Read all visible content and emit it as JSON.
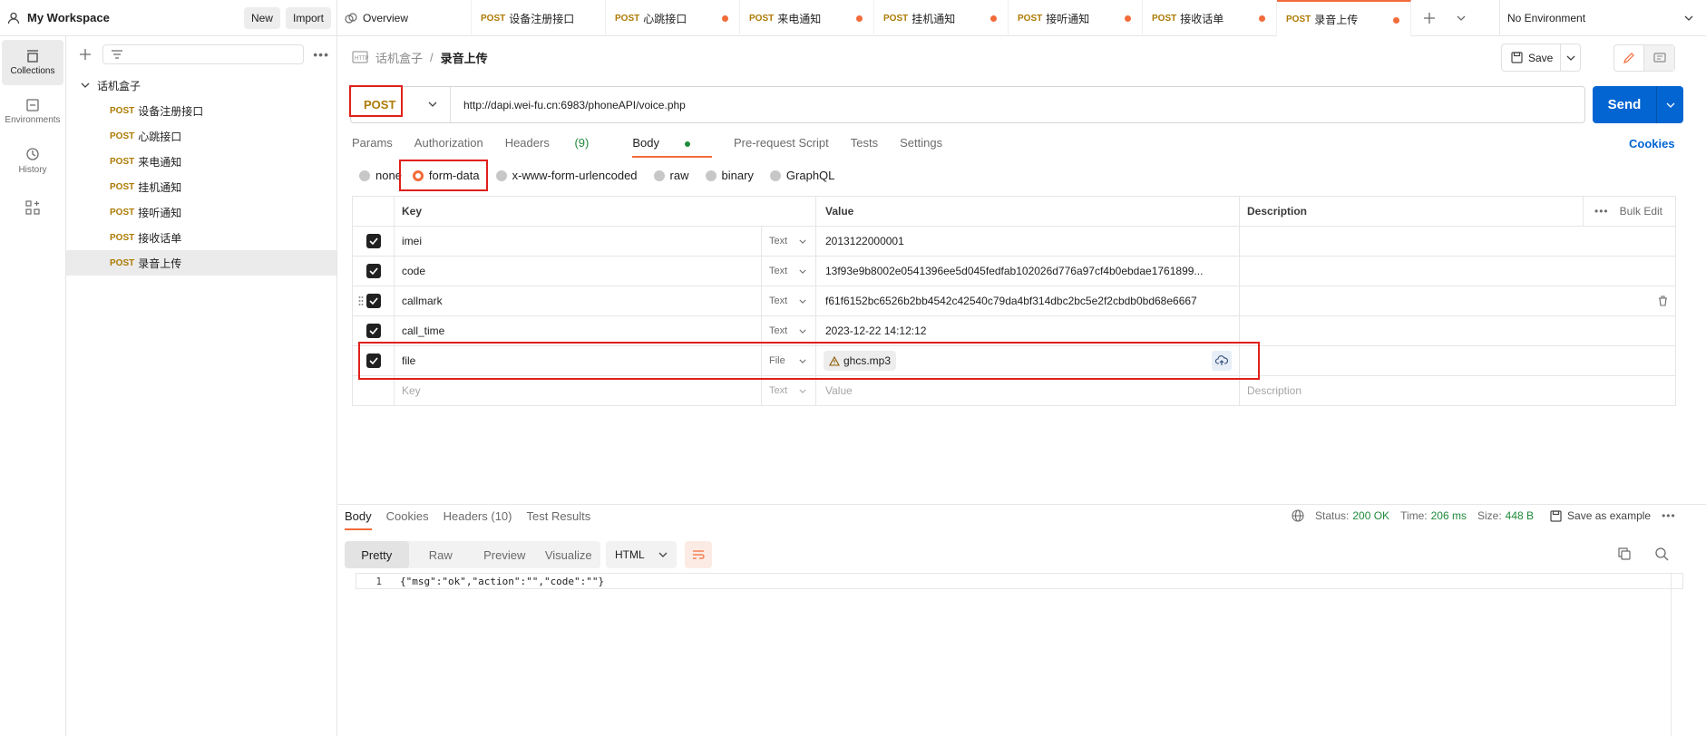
{
  "workspace": {
    "name": "My Workspace",
    "new_label": "New",
    "import_label": "Import"
  },
  "tabs": [
    {
      "label": "Overview"
    },
    {
      "method": "POST",
      "label": "设备注册接口"
    },
    {
      "method": "POST",
      "label": "心跳接口"
    },
    {
      "method": "POST",
      "label": "来电通知"
    },
    {
      "method": "POST",
      "label": "挂机通知"
    },
    {
      "method": "POST",
      "label": "接听通知"
    },
    {
      "method": "POST",
      "label": "接收话单"
    },
    {
      "method": "POST",
      "label": "录音上传"
    }
  ],
  "environment": "No Environment",
  "rail": [
    {
      "label": "Collections"
    },
    {
      "label": "Environments"
    },
    {
      "label": "History"
    }
  ],
  "collection": {
    "name": "话机盒子",
    "items": [
      {
        "method": "POST",
        "label": "设备注册接口"
      },
      {
        "method": "POST",
        "label": "心跳接口"
      },
      {
        "method": "POST",
        "label": "来电通知"
      },
      {
        "method": "POST",
        "label": "挂机通知"
      },
      {
        "method": "POST",
        "label": "接听通知"
      },
      {
        "method": "POST",
        "label": "接收话单"
      },
      {
        "method": "POST",
        "label": "录音上传"
      }
    ]
  },
  "breadcrumb": {
    "parent": "话机盒子",
    "sep": "/",
    "current": "录音上传"
  },
  "save_label": "Save",
  "request": {
    "method": "POST",
    "url": "http://dapi.wei-fu.cn:6983/phoneAPI/voice.php",
    "send_label": "Send"
  },
  "req_tabs": [
    "Params",
    "Authorization",
    "Headers",
    "(9)",
    "Body",
    "Pre-request Script",
    "Tests",
    "Settings"
  ],
  "cookies_label": "Cookies",
  "body_types": [
    "none",
    "form-data",
    "x-www-form-urlencoded",
    "raw",
    "binary",
    "GraphQL"
  ],
  "table": {
    "headers": {
      "key": "Key",
      "value": "Value",
      "description": "Description",
      "bulk": "Bulk Edit"
    },
    "rows": [
      {
        "key": "imei",
        "type": "Text",
        "value": "2013122000001"
      },
      {
        "key": "code",
        "type": "Text",
        "value": "13f93e9b8002e0541396ee5d045fedfab102026d776a97cf4b0ebdae1761899..."
      },
      {
        "key": "callmark",
        "type": "Text",
        "value": "f61f6152bc6526b2bb4542c42540c79da4bf314dbc2bc5e2f2cbdb0bd68e6667"
      },
      {
        "key": "call_time",
        "type": "Text",
        "value": "2023-12-22 14:12:12"
      },
      {
        "key": "file",
        "type": "File",
        "value": "ghcs.mp3"
      }
    ],
    "placeholder": {
      "key": "Key",
      "type": "Text",
      "value": "Value",
      "description": "Description"
    }
  },
  "response": {
    "tabs": [
      "Body",
      "Cookies",
      "Headers (10)",
      "Test Results"
    ],
    "status_label": "Status:",
    "status": "200 OK",
    "time_label": "Time:",
    "time": "206 ms",
    "size_label": "Size:",
    "size": "448 B",
    "save_example": "Save as example",
    "views": [
      "Pretty",
      "Raw",
      "Preview",
      "Visualize"
    ],
    "format": "HTML",
    "line_no": "1",
    "body": "{\"msg\":\"ok\",\"action\":\"\",\"code\":\"\"}"
  }
}
